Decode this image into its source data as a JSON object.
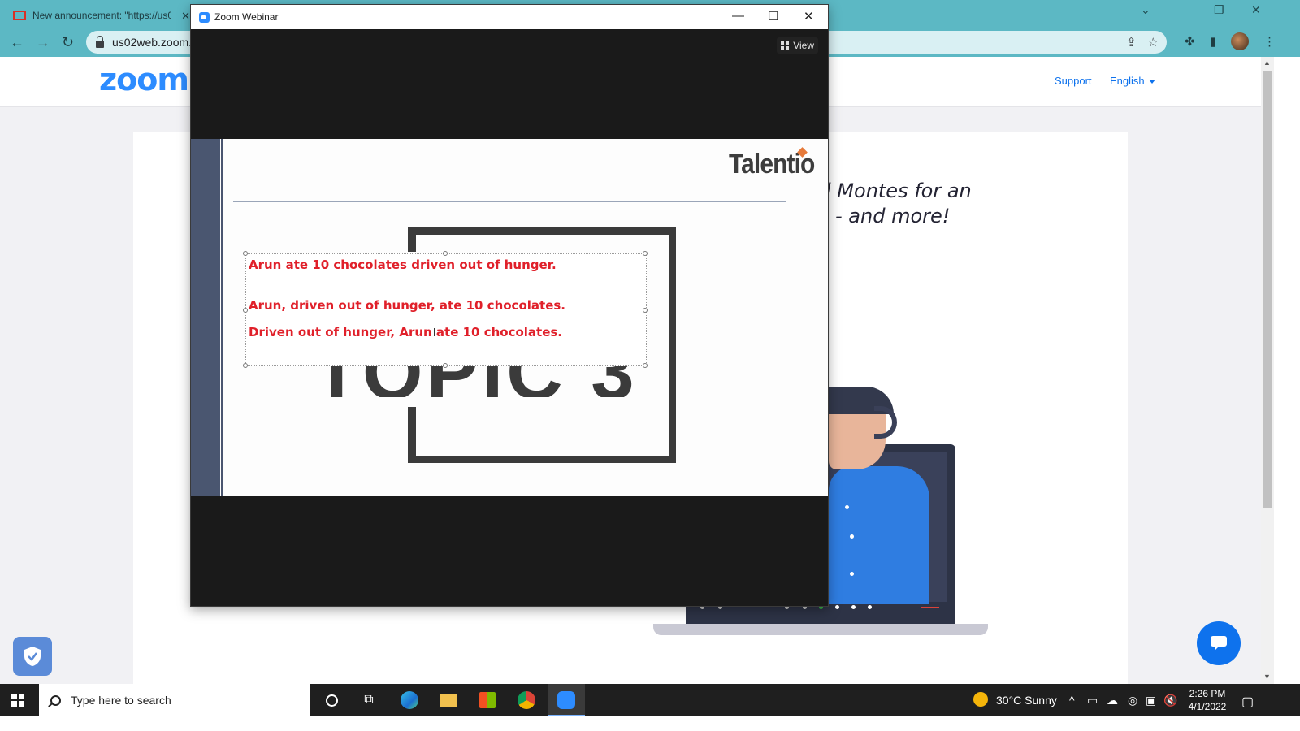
{
  "browser": {
    "tab_title": "New announcement: \"https://us0",
    "url": "us02web.zoom.",
    "colors": {
      "frame": "#5cb8c4"
    }
  },
  "zoom_page": {
    "logo": "zoom",
    "support": "Support",
    "language": "English",
    "promo_line1": "l Montes for an",
    "promo_line2": "- and more!",
    "colors": {
      "brand": "#2d8cff",
      "link": "#0e72ed"
    }
  },
  "webinar": {
    "title": "Zoom Webinar",
    "view_label": "View",
    "slide": {
      "brand": "Talentio",
      "topic_text": "TOPIC 3",
      "lines": [
        "Arun ate 10 chocolates driven out of hunger.",
        "Arun, driven out of hunger, ate 10 chocolates.",
        "Driven out of hunger, Arun ate 10 chocolates."
      ],
      "text_color": "#e0202a"
    }
  },
  "taskbar": {
    "search_placeholder": "Type here to search",
    "weather": "30°C  Sunny",
    "time": "2:26 PM",
    "date": "4/1/2022"
  }
}
